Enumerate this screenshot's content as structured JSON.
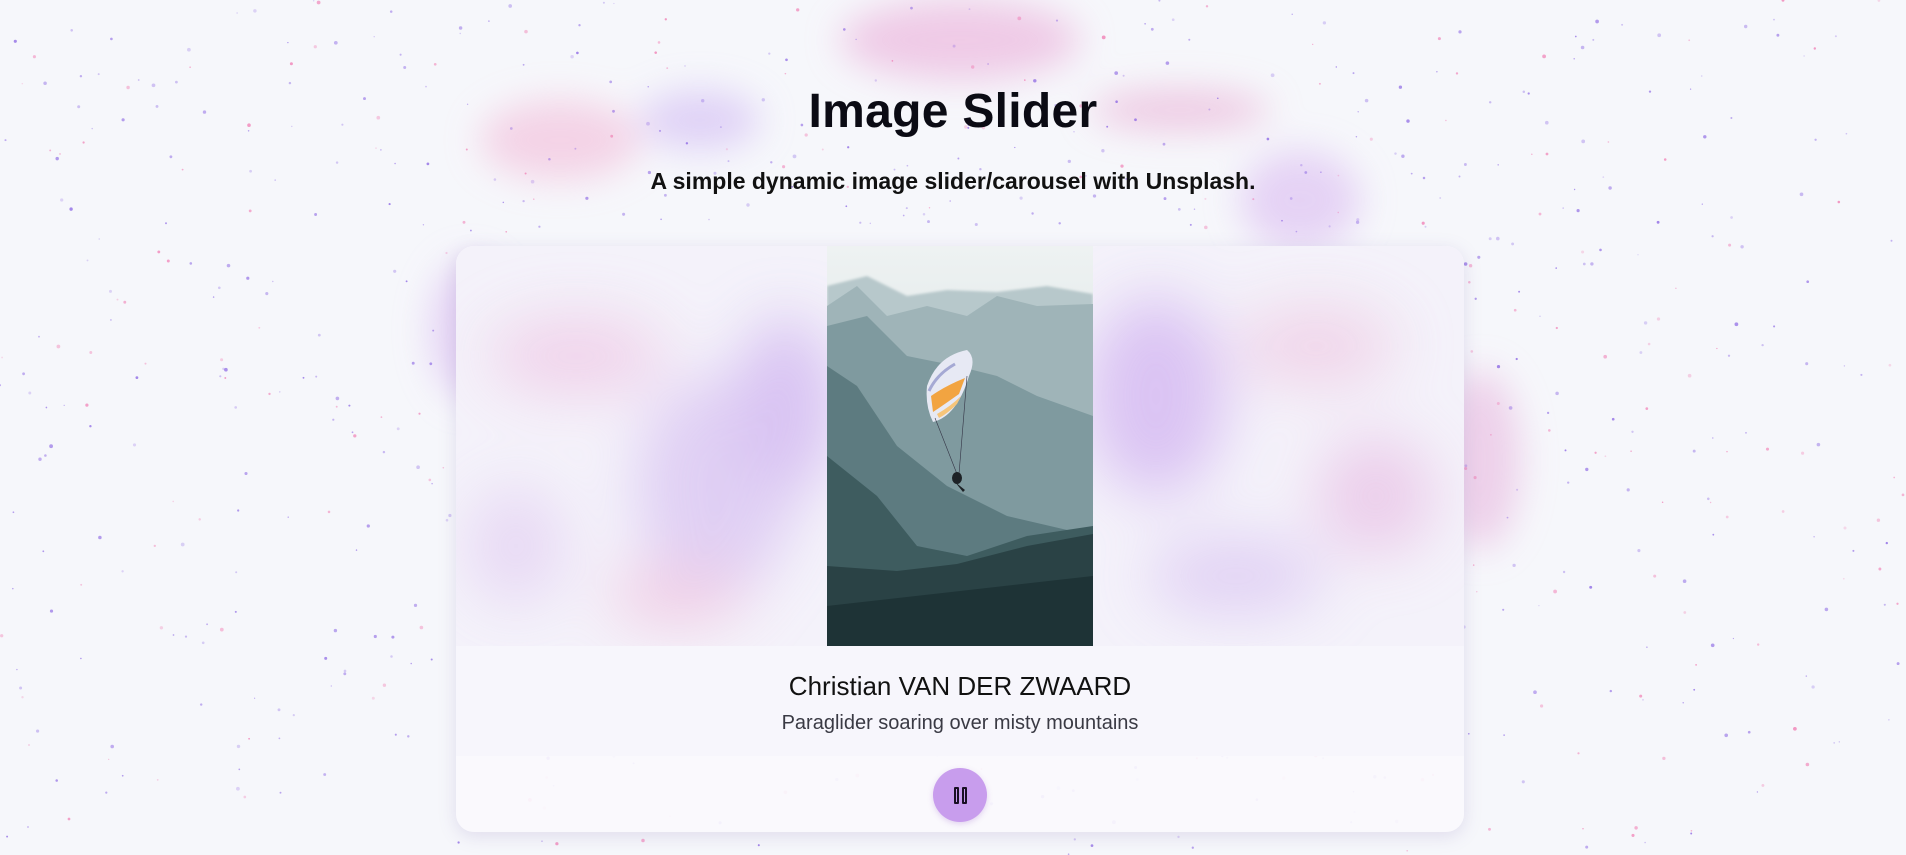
{
  "header": {
    "title": "Image Slider",
    "subtitle": "A simple dynamic image slider/carousel with Unsplash."
  },
  "slide": {
    "photographer": "Christian VAN DER ZWAARD",
    "description": "Paraglider soaring over misty mountains",
    "image_alt": "Paraglider soaring over misty mountains"
  },
  "controls": {
    "pause_label": "Pause",
    "pause_icon": "pause-icon"
  },
  "colors": {
    "page_background": "#f6f7fb",
    "accent": "#c89ded",
    "splash_purple": "#7a4fe0",
    "splash_pink": "#f06aa8"
  }
}
